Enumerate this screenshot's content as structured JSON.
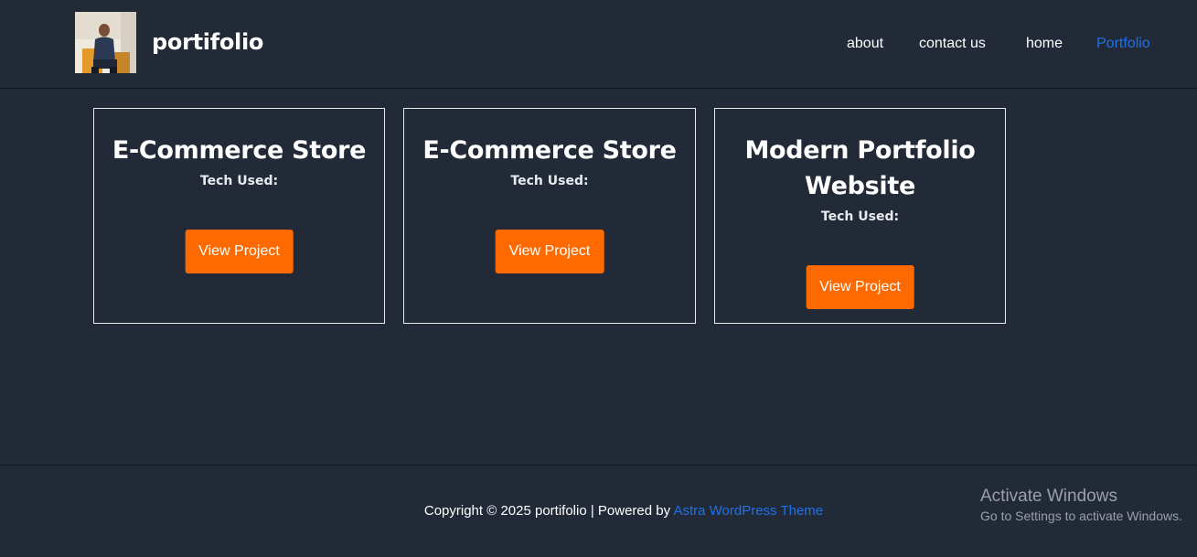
{
  "site": {
    "title": "portifolio"
  },
  "nav": {
    "items": [
      {
        "label": "about"
      },
      {
        "label": "contact us"
      },
      {
        "label": "home"
      },
      {
        "label": "Portfolio",
        "active": true
      }
    ]
  },
  "projects": [
    {
      "title": "E-Commerce Store",
      "tech_label": "Tech Used:",
      "button": "View Project"
    },
    {
      "title": "E-Commerce Store",
      "tech_label": "Tech Used:",
      "button": "View Project"
    },
    {
      "title": "Modern Portfolio Website",
      "tech_label": "Tech Used:",
      "button": "View Project"
    }
  ],
  "footer": {
    "copyright_prefix": "Copyright © 2025 portifolio | Powered by ",
    "theme_link": "Astra WordPress Theme"
  },
  "windows_watermark": {
    "line1": "Activate Windows",
    "line2": "Go to Settings to activate Windows."
  },
  "colors": {
    "background": "#222a37",
    "accent_button": "#ff6a00",
    "link_blue": "#1e72e8",
    "card_border": "#e6e8ea"
  }
}
